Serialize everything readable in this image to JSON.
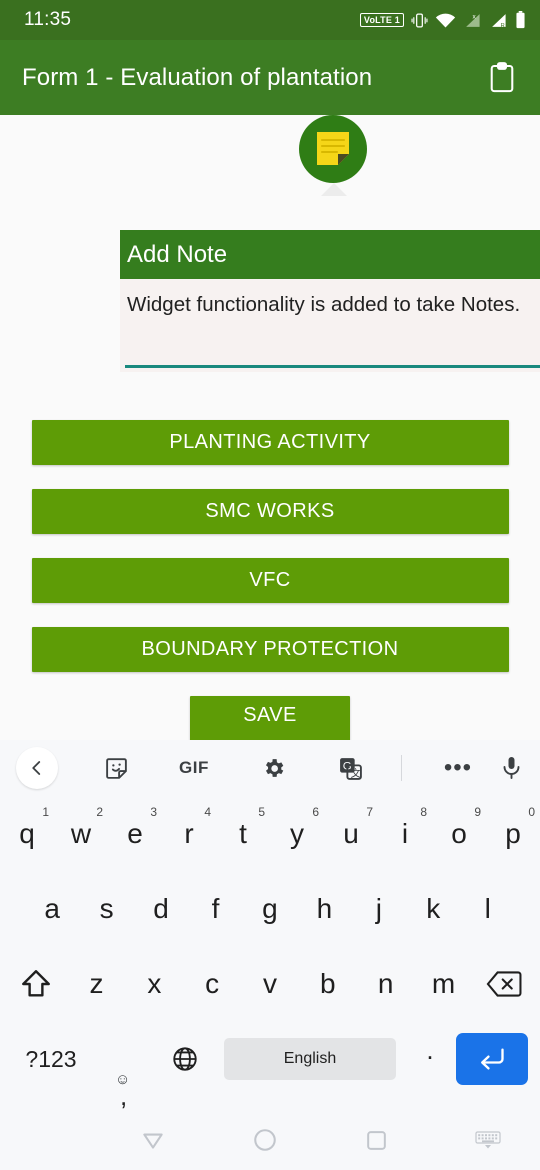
{
  "status_bar": {
    "time": "11:35",
    "volte_label": "VoLTE 1",
    "icons": [
      "vibrate-icon",
      "wifi-icon",
      "signal-1-icon",
      "signal-2-icon",
      "battery-icon"
    ]
  },
  "app_bar": {
    "title": "Form 1 - Evaluation of plantation",
    "action_icon": "clipboard-icon"
  },
  "note_widget": {
    "avatar_icon": "sticky-note-icon",
    "header_title": "Add Note",
    "body_text": "Widget functionality is added to take Notes.",
    "header_color": "#357d1e",
    "body_color": "#f7f2f1",
    "underline_color": "#19897e"
  },
  "buttons": {
    "accent_color": "#5e9c06",
    "items": [
      {
        "label": "PLANTING ACTIVITY"
      },
      {
        "label": "SMC WORKS"
      },
      {
        "label": "VFC"
      },
      {
        "label": "BOUNDARY PROTECTION"
      }
    ],
    "save_label": "SAVE"
  },
  "keyboard": {
    "toolbar": [
      {
        "name": "back-chevron-icon",
        "label": ""
      },
      {
        "name": "sticker-icon",
        "label": ""
      },
      {
        "name": "gif-icon",
        "label": "GIF"
      },
      {
        "name": "gear-icon",
        "label": ""
      },
      {
        "name": "translate-icon",
        "label": ""
      },
      {
        "name": "more-icon",
        "label": ""
      },
      {
        "name": "microphone-icon",
        "label": ""
      }
    ],
    "row1": [
      {
        "key": "q",
        "num": "1"
      },
      {
        "key": "w",
        "num": "2"
      },
      {
        "key": "e",
        "num": "3"
      },
      {
        "key": "r",
        "num": "4"
      },
      {
        "key": "t",
        "num": "5"
      },
      {
        "key": "y",
        "num": "6"
      },
      {
        "key": "u",
        "num": "7"
      },
      {
        "key": "i",
        "num": "8"
      },
      {
        "key": "o",
        "num": "9"
      },
      {
        "key": "p",
        "num": "0"
      }
    ],
    "row2": [
      {
        "key": "a"
      },
      {
        "key": "s"
      },
      {
        "key": "d"
      },
      {
        "key": "f"
      },
      {
        "key": "g"
      },
      {
        "key": "h"
      },
      {
        "key": "j"
      },
      {
        "key": "k"
      },
      {
        "key": "l"
      }
    ],
    "row3": [
      {
        "key": "z"
      },
      {
        "key": "x"
      },
      {
        "key": "c"
      },
      {
        "key": "v"
      },
      {
        "key": "b"
      },
      {
        "key": "n"
      },
      {
        "key": "m"
      }
    ],
    "symbols_label": "?123",
    "comma_label": ",",
    "period_label": ".",
    "space_label": "English",
    "enter_color": "#1a73e8"
  },
  "nav_bar": {
    "back_icon": "nav-back-triangle-icon",
    "home_icon": "nav-home-circle-icon",
    "recents_icon": "nav-recents-square-icon",
    "hide_keyboard_icon": "hide-keyboard-icon"
  }
}
